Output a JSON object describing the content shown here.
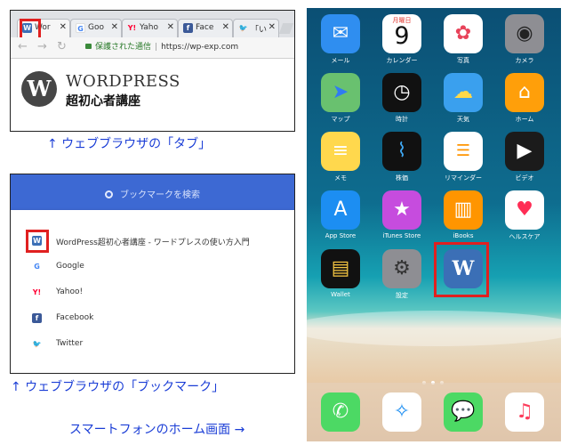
{
  "browser": {
    "tabs": [
      {
        "label": "Wor",
        "icon": "wordpress-icon",
        "color": "#3b6fb6",
        "active": true
      },
      {
        "label": "Goo",
        "icon": "google-icon",
        "color": "#4285f4",
        "active": false
      },
      {
        "label": "Yaho",
        "icon": "yahoo-icon",
        "color": "#ff0033",
        "active": false
      },
      {
        "label": "Face",
        "icon": "facebook-icon",
        "color": "#3b5998",
        "active": false
      },
      {
        "label": "「いま",
        "icon": "twitter-icon",
        "color": "#1da1f2",
        "active": false
      }
    ],
    "secure_label": "保護された通信",
    "url": "https://wp-exp.com",
    "logo_word": "WORDPRESS",
    "logo_sub": "超初心者講座"
  },
  "captions": {
    "tab": "↑ ウェブブラウザの「タブ」",
    "bookmark": "↑ ウェブブラウザの「ブックマーク」",
    "home": "スマートフォンのホーム画面 →"
  },
  "bookmarks": {
    "search_placeholder": "ブックマークを検索",
    "items": [
      {
        "label": "WordPress超初心者講座 - ワードプレスの使い方入門",
        "icon": "wordpress-icon",
        "color": "#3b6fb6"
      },
      {
        "label": "Google",
        "icon": "google-icon",
        "color": "#4285f4"
      },
      {
        "label": "Yahoo!",
        "icon": "yahoo-icon",
        "color": "#ff0033"
      },
      {
        "label": "Facebook",
        "icon": "facebook-icon",
        "color": "#3b5998"
      },
      {
        "label": "Twitter",
        "icon": "twitter-icon",
        "color": "#1da1f2"
      }
    ]
  },
  "phone": {
    "calendar_day": "月曜日",
    "calendar_date": "9",
    "apps": [
      {
        "name": "メール",
        "icon": "mail-icon",
        "color": "#2f8ef0"
      },
      {
        "name": "カレンダー",
        "icon": "calendar-icon",
        "color": "#ffffff"
      },
      {
        "name": "写真",
        "icon": "photos-icon",
        "color": "#ffffff"
      },
      {
        "name": "カメラ",
        "icon": "camera-icon",
        "color": "#8e8e93"
      },
      {
        "name": "マップ",
        "icon": "maps-icon",
        "color": "#69c16f"
      },
      {
        "name": "時計",
        "icon": "clock-icon",
        "color": "#111111"
      },
      {
        "name": "天気",
        "icon": "weather-icon",
        "color": "#3aa0ee"
      },
      {
        "name": "ホーム",
        "icon": "home-icon",
        "color": "#ff9f0a"
      },
      {
        "name": "メモ",
        "icon": "notes-icon",
        "color": "#ffd84d"
      },
      {
        "name": "株価",
        "icon": "stocks-icon",
        "color": "#111111"
      },
      {
        "name": "リマインダー",
        "icon": "reminders-icon",
        "color": "#ffffff"
      },
      {
        "name": "ビデオ",
        "icon": "videos-icon",
        "color": "#1b1b1b"
      },
      {
        "name": "App Store",
        "icon": "appstore-icon",
        "color": "#1c8ef2"
      },
      {
        "name": "iTunes Store",
        "icon": "itunes-icon",
        "color": "#c64cde"
      },
      {
        "name": "iBooks",
        "icon": "books-icon",
        "color": "#ff9500"
      },
      {
        "name": "ヘルスケア",
        "icon": "health-icon",
        "color": "#ffffff"
      },
      {
        "name": "Wallet",
        "icon": "wallet-icon",
        "color": "#111111"
      },
      {
        "name": "設定",
        "icon": "settings-icon",
        "color": "#8e8e93"
      },
      {
        "name": "WordPress",
        "icon": "wordpress-icon",
        "color": "#3b6fb6"
      }
    ],
    "dock": [
      {
        "icon": "phone-icon",
        "color": "#4cd964"
      },
      {
        "icon": "safari-icon",
        "color": "#ffffff"
      },
      {
        "icon": "messages-icon",
        "color": "#4cd964"
      },
      {
        "icon": "music-icon",
        "color": "#ffffff"
      }
    ]
  }
}
